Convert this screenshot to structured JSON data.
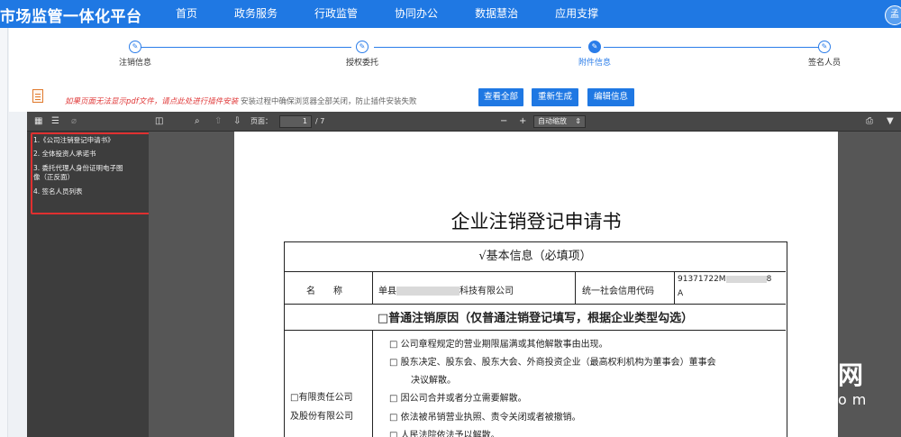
{
  "header": {
    "brand": "市场监管一体化平台",
    "nav": [
      "首页",
      "政务服务",
      "行政监管",
      "协同办公",
      "数据慧治",
      "应用支撑"
    ],
    "avatar_letter": "孟"
  },
  "stepper": {
    "steps": [
      {
        "label": "注销信息",
        "icon": "edit-icon",
        "active": false
      },
      {
        "label": "授权委托",
        "icon": "edit-icon",
        "active": false
      },
      {
        "label": "附件信息",
        "icon": "edit-icon",
        "active": true
      },
      {
        "label": "签名人员",
        "icon": "edit-icon",
        "active": false
      }
    ]
  },
  "notice": {
    "red_text": "如果页面无法显示pdf文件，请点此处进行插件安装",
    "gray_text": "安装过程中确保浏览器全部关闭，防止插件安装失败"
  },
  "buttons": {
    "view_all": "查看全部",
    "regenerate": "重新生成",
    "edit_info": "编辑信息"
  },
  "pdf_toolbar": {
    "page_label": "页面：",
    "page_current": "1",
    "page_total": "/ 7",
    "zoom_minus": "−",
    "zoom_plus": "+",
    "zoom_select": "自动缩放"
  },
  "outline": {
    "items": [
      "1.《公司注销登记申请书》",
      "2. 全体投资人承诺书",
      "3. 委托代理人身份证明电子图",
      "像（正反面）",
      "4. 签名人员列表"
    ]
  },
  "document": {
    "title": "企业注销登记申请书",
    "basic_info_header": "√基本信息（必填项）",
    "name_label": "名　　称",
    "name_prefix": "单县",
    "name_suffix": "科技有限公司",
    "credit_label": "统一社会信用代码",
    "credit_prefix": "91371722M",
    "credit_suffix": "8",
    "credit_line2": "A",
    "reason_header": "□普通注销原因（仅普通注销登记填写，根据企业类型勾选）",
    "company_type_line1": "□有限责任公司",
    "company_type_line2": "及股份有限公司",
    "reasons": [
      "□  公司章程规定的营业期限届满或其他解散事由出现。",
      "□  股东决定、股东会、股东大会、外商投资企业（最高权利机构为董事会）董事会",
      "决议解散。",
      "□  因公司合并或者分立需要解散。",
      "□  依法被吊销营业执照、责令关闭或者被撤销。",
      "□  人民法院依法予以解散。"
    ]
  },
  "watermark": {
    "main": "网",
    "sub": "om"
  }
}
